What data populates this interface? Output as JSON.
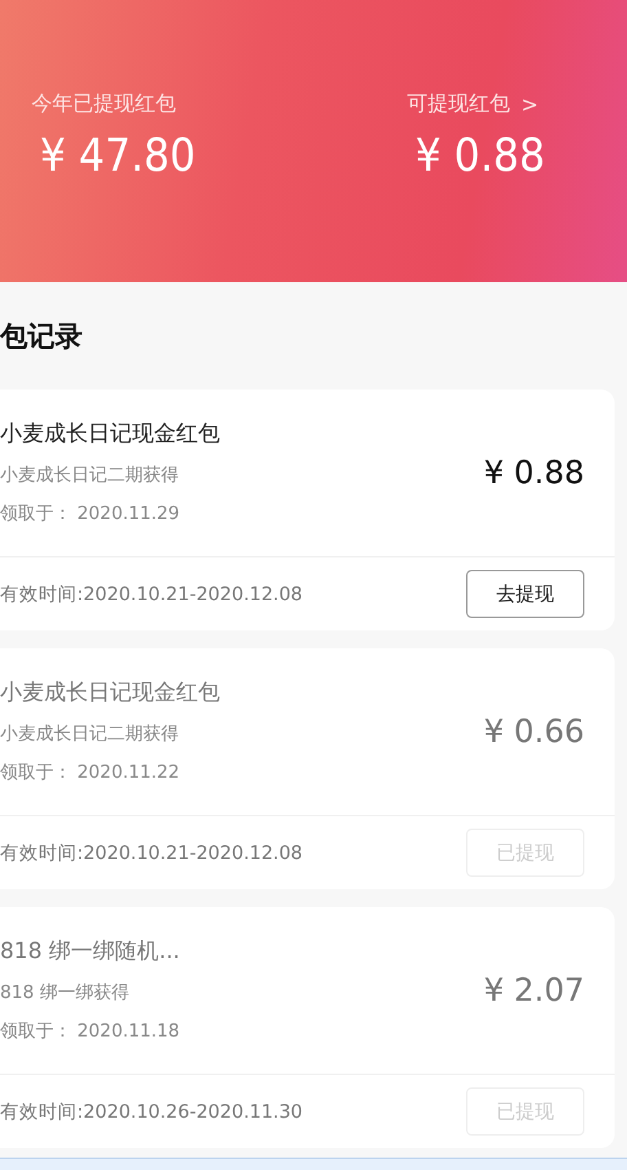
{
  "header": {
    "withdrawn_total": {
      "label": "今年已提现红包",
      "amount": "¥ 47.80"
    },
    "available": {
      "label": "可提现红包",
      "arrow": ">",
      "amount": "¥ 0.88"
    }
  },
  "section_title": "包记录",
  "records": [
    {
      "title": "小麦成长日记现金红包",
      "source": "小麦成长日记二期获得",
      "received": "领取于：  2020.11.29",
      "amount": "¥ 0.88",
      "validity": "有效时间:2020.10.21-2020.12.08",
      "button": "去提现",
      "withdrawn": false
    },
    {
      "title": "小麦成长日记现金红包",
      "source": "小麦成长日记二期获得",
      "received": "领取于：  2020.11.22",
      "amount": "¥ 0.66",
      "validity": "有效时间:2020.10.21-2020.12.08",
      "button": "已提现",
      "withdrawn": true
    },
    {
      "title": "818 绑一绑随机...",
      "source": "818 绑一绑获得",
      "received": "领取于：  2020.11.18",
      "amount": "¥ 2.07",
      "validity": "有效时间:2020.10.26-2020.11.30",
      "button": "已提现",
      "withdrawn": true
    }
  ]
}
